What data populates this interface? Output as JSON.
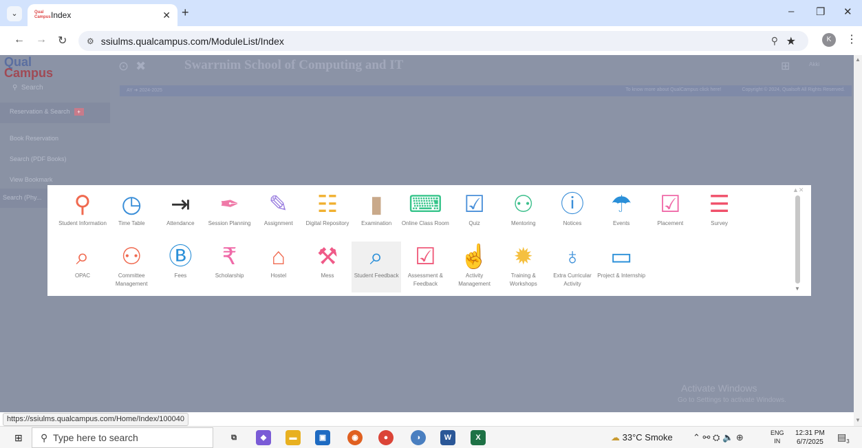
{
  "browser": {
    "tab_title": "Index",
    "tab_favicon_text": "Qual\nCampus",
    "url": "ssiulms.qualcampus.com/ModuleList/Index",
    "profile_initial": "K"
  },
  "page": {
    "logo_line1": "Qual",
    "logo_line2": "Campus",
    "school_name": "Swarrnim School of Computing and IT",
    "header_right_small": "Akki",
    "info_left": "AY ➜ 2024-2025",
    "info_mid": "To know more about QualCampus click here!",
    "info_right": "Copyright © 2024, Qualsoft All Rights Reserved.",
    "sidebar": {
      "search_placeholder": "Search",
      "items": [
        {
          "label": "Reservation & Search",
          "badge": "+"
        },
        {
          "label": "Book Reservation"
        },
        {
          "label": "Search (PDF Books)"
        },
        {
          "label": "View Bookmark"
        },
        {
          "label": "Search (Phy..."
        }
      ]
    },
    "apps_row1": [
      {
        "label": "Student Information",
        "icon": "person-icon",
        "glyph": "⚲",
        "color": "#f06a50"
      },
      {
        "label": "Time Table",
        "icon": "clock-icon",
        "glyph": "◷",
        "color": "#3a8ed8"
      },
      {
        "label": "Attendance",
        "icon": "sign-in-icon",
        "glyph": "⇥",
        "color": "#333333"
      },
      {
        "label": "Session Planning",
        "icon": "pen-icon",
        "glyph": "✒",
        "color": "#ef7aa8"
      },
      {
        "label": "Assignment",
        "icon": "edit-icon",
        "glyph": "✎",
        "color": "#9b7fe0"
      },
      {
        "label": "Digital Repository",
        "icon": "document-icon",
        "glyph": "☷",
        "color": "#f0b030"
      },
      {
        "label": "Examination",
        "icon": "clipboard-icon",
        "glyph": "▮",
        "color": "#c9a98a"
      },
      {
        "label": "Online Class Room",
        "icon": "keyboard-icon",
        "glyph": "⌨",
        "color": "#36c48a"
      },
      {
        "label": "Quiz",
        "icon": "checkbox-icon",
        "glyph": "☑",
        "color": "#4a90d9"
      },
      {
        "label": "Mentoring",
        "icon": "users-icon",
        "glyph": "⚇",
        "color": "#3dbf8c"
      },
      {
        "label": "Notices",
        "icon": "exclamation-icon",
        "glyph": "ⓘ",
        "color": "#3a8ed8"
      },
      {
        "label": "Events",
        "icon": "trophy-icon",
        "glyph": "☂",
        "color": "#2a8fd8"
      },
      {
        "label": "Placement",
        "icon": "calendar-check-icon",
        "glyph": "☑",
        "color": "#ef6aa8"
      },
      {
        "label": "Survey",
        "icon": "sliders-icon",
        "glyph": "☰",
        "color": "#f0506a"
      }
    ],
    "apps_row2": [
      {
        "label": "OPAC",
        "icon": "search-icon",
        "glyph": "⌕",
        "color": "#f06a50"
      },
      {
        "label": "Committee Management",
        "icon": "group-icon",
        "glyph": "⚇",
        "color": "#f06a50"
      },
      {
        "label": "Fees",
        "icon": "money-icon",
        "glyph": "Ⓑ",
        "color": "#2a8fd8"
      },
      {
        "label": "Scholarship",
        "icon": "rupee-icon",
        "glyph": "₹",
        "color": "#ef6aa8"
      },
      {
        "label": "Hostel",
        "icon": "home-icon",
        "glyph": "⌂",
        "color": "#f06a50"
      },
      {
        "label": "Mess",
        "icon": "cutlery-icon",
        "glyph": "⚒",
        "color": "#ef5a88"
      },
      {
        "label": "Student Feedback",
        "icon": "magnifier-icon",
        "glyph": "⌕",
        "color": "#2a8fd8"
      },
      {
        "label": "Assessment & Feedback",
        "icon": "check-square-icon",
        "glyph": "☑",
        "color": "#ef5a7a"
      },
      {
        "label": "Activity Management",
        "icon": "thumbs-up-icon",
        "glyph": "☝",
        "color": "#3a8ed8"
      },
      {
        "label": "Training & Workshops",
        "icon": "sun-icon",
        "glyph": "✹",
        "color": "#f5c040"
      },
      {
        "label": "Extra Curricular Activity",
        "icon": "microphone-icon",
        "glyph": "♁",
        "color": "#3a8ed8"
      },
      {
        "label": "Project & Internship",
        "icon": "laptop-icon",
        "glyph": "▭",
        "color": "#2a8fd8"
      }
    ],
    "watermark_line1": "Activate Windows",
    "watermark_line2": "Go to Settings to activate Windows."
  },
  "status_url": "https://ssiulms.qualcampus.com/Home/Index/100040",
  "taskbar": {
    "search_placeholder": "Type here to search",
    "weather": "33°C  Smoke",
    "lang_top": "ENG",
    "lang_bottom": "IN",
    "time": "12:31 PM",
    "date": "6/7/2025",
    "notif_count": "3"
  }
}
